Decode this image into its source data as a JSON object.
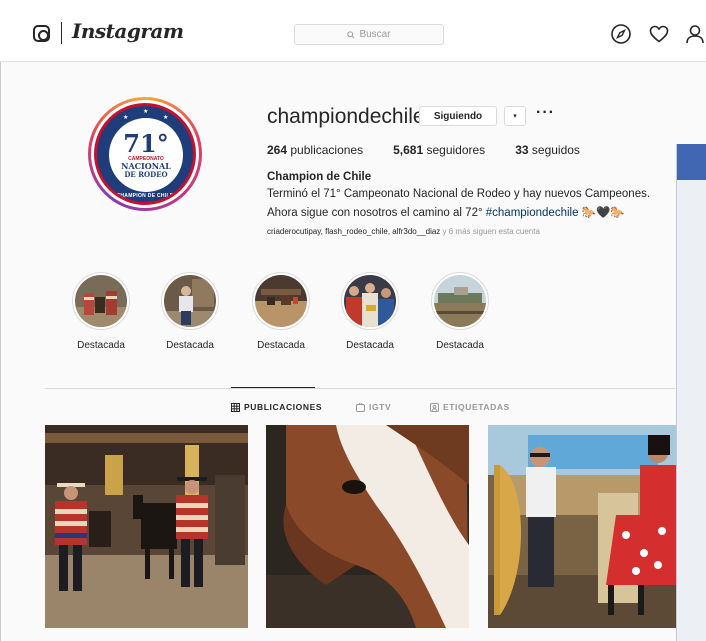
{
  "header": {
    "brand": "Instagram",
    "search_placeholder": "Buscar"
  },
  "profile": {
    "username": "championdechile",
    "follow_label": "Siguiendo",
    "dropdown_glyph": "▾",
    "more_glyph": "···",
    "stats": {
      "posts_count": "264",
      "posts_label": "publicaciones",
      "followers_count": "5,681",
      "followers_label": "seguidores",
      "following_count": "33",
      "following_label": "seguidos"
    },
    "full_name": "Champion de Chile",
    "bio_line1": "Terminó el 71° Campeonato Nacional de Rodeo y hay nuevos Campeones.",
    "bio_line2_prefix": "Ahora sigue con nosotros el camino al 72° ",
    "bio_hashtag": "#championdechile",
    "bio_emoji": "🐎🖤🐎",
    "followed_by": "criaderocutipay, flash_rodeo_chile, alfr3do__diaz",
    "followed_by_more": " y 6 más siguen esta cuenta"
  },
  "logo_badge": {
    "number": "71°",
    "line1": "CAMPEONATO",
    "line2": "NACIONAL",
    "line3": "DE RODEO",
    "arc_text": "CHAMPION DE CHILE"
  },
  "highlights": [
    {
      "label": "Destacada"
    },
    {
      "label": "Destacada"
    },
    {
      "label": "Destacada"
    },
    {
      "label": "Destacada"
    },
    {
      "label": "Destacada"
    }
  ],
  "tabs": [
    {
      "label": "PUBLICACIONES",
      "active": true,
      "icon": "grid-icon"
    },
    {
      "label": "IGTV",
      "active": false,
      "icon": "igtv-icon"
    },
    {
      "label": "ETIQUETADAS",
      "active": false,
      "icon": "tagged-icon"
    }
  ],
  "colors": {
    "text": "#262626",
    "muted": "#999999",
    "border": "#dbdbdb",
    "hashtag": "#003569",
    "badge_blue": "#1f3d7a",
    "badge_red": "#c8102e"
  }
}
